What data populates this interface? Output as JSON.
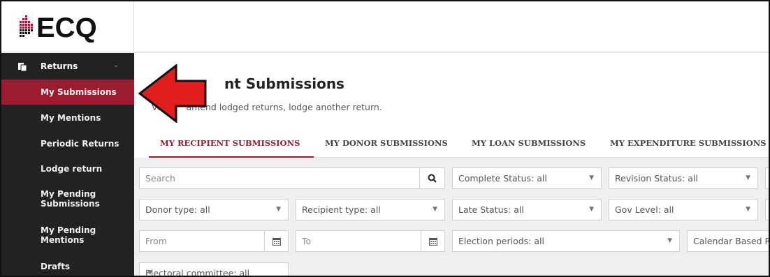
{
  "app": {
    "logo_text": "ECQ",
    "brand_color": "#9b1b30"
  },
  "sidebar": {
    "section_label": "Returns",
    "items": [
      {
        "label": "My Submissions",
        "active": true
      },
      {
        "label": "My Mentions"
      },
      {
        "label": "Periodic Returns"
      },
      {
        "label": "Lodge return"
      },
      {
        "label": "My Pending Submissions"
      },
      {
        "label": "My Pending Mentions"
      },
      {
        "label": "Drafts"
      }
    ]
  },
  "page": {
    "title": "Recipient Submissions",
    "title_visible": "nt Submissions",
    "subtitle_visible": "lodged returns, lodge another return.",
    "subtitle_prefix": "Vie",
    "subtitle_mid": "amend"
  },
  "tabs": [
    {
      "label": "MY RECIPIENT SUBMISSIONS",
      "active": true
    },
    {
      "label": "MY DONOR SUBMISSIONS"
    },
    {
      "label": "MY LOAN SUBMISSIONS"
    },
    {
      "label": "MY EXPENDITURE SUBMISSIONS"
    }
  ],
  "filters": {
    "search_placeholder": "Search",
    "complete_status": "Complete Status: all",
    "revision_status": "Revision Status: all",
    "donor_type": "Donor type: all",
    "recipient_type": "Recipient type: all",
    "late_status": "Late Status: all",
    "gov_level": "Gov Level: all",
    "from_placeholder": "From",
    "to_placeholder": "To",
    "election_periods": "Election periods: all",
    "calendar_based": "Calendar Based R",
    "electoral_committee": "Electoral committee: all"
  },
  "icons": {
    "search": "search-icon",
    "calendar": "calendar-icon",
    "caret": "caret-down-icon",
    "arrow_color": "#e01e1e"
  }
}
